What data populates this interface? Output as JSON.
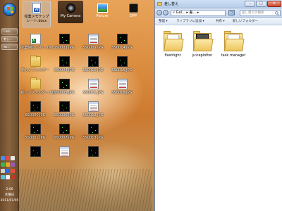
{
  "taskbar": {
    "buttons": [
      {
        "label": "Cam..."
      },
      {
        "label": "差し..."
      },
      {
        "label": "ws..."
      }
    ],
    "clock": {
      "time": "2:06",
      "day": "水曜日",
      "date": "2011/01/05"
    }
  },
  "topbar": {
    "apps": [
      {
        "label": "授業メモテンプレート.docx",
        "icon": "word-document-icon"
      },
      {
        "label": "My Camera",
        "icon": "camera-icon"
      },
      {
        "label": "Picture",
        "icon": "picture-icon"
      },
      {
        "label": "DPP",
        "icon": "dpp-icon"
      }
    ]
  },
  "desktop": {
    "icons": [
      {
        "label": "授業時間リスト.xlsx",
        "type": "excel"
      },
      {
        "label": "SS0003.JPG",
        "type": "black"
      },
      {
        "label": "SS0009.JPG",
        "type": "window"
      },
      {
        "label": "SS0014.JPG",
        "type": "black"
      },
      {
        "label": "新しいフォルダー",
        "type": "folder"
      },
      {
        "label": "SS0004.JPG",
        "type": "black"
      },
      {
        "label": "SS0010.JPG",
        "type": "black"
      },
      {
        "label": "SS0015.JPG",
        "type": "black"
      },
      {
        "label": "新しいフォルダー (2)",
        "type": "folder"
      },
      {
        "label": "SS0005.JPG",
        "type": "black"
      },
      {
        "label": "SS0011.JPG",
        "type": "window"
      },
      {
        "label": "SS0016.JPG",
        "type": "window"
      },
      {
        "label": "SS0000.JPG",
        "type": "black"
      },
      {
        "label": "SS0006.JPG",
        "type": "black"
      },
      {
        "label": "SS0012.JPG",
        "type": "window"
      },
      {
        "label": "SS0001.JPG",
        "type": "black"
      },
      {
        "label": "SS0007.JPG",
        "type": "black"
      },
      {
        "label": "SS0013.JPG",
        "type": "black"
      },
      {
        "label": "",
        "type": "black"
      },
      {
        "label": "",
        "type": "window"
      },
      {
        "label": "",
        "type": "black"
      }
    ]
  },
  "explorer": {
    "title": "差し替え",
    "address": "« Gal... ▸ 差... ▸",
    "search_placeholder": "差し替えの検索",
    "toolbar": {
      "organize": "整理 ▾",
      "add_to_library": "ライブラリに追加 ▾",
      "share": "共有 ▾",
      "new_folder": "新しいフォルダー"
    },
    "folders": [
      {
        "label": "flashlight",
        "style": "paper"
      },
      {
        "label": "juiceplotter",
        "style": "dark"
      },
      {
        "label": "task manager",
        "style": "paper"
      }
    ]
  }
}
